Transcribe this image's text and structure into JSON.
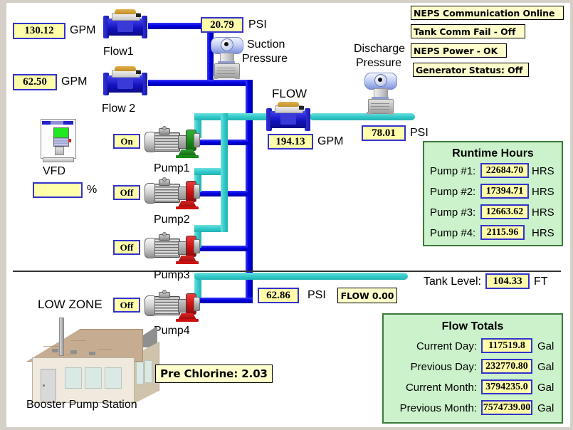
{
  "title": "Booster Pump Station",
  "flow_inputs": [
    {
      "name": "flow1",
      "value": "130.12",
      "unit": "GPM",
      "label": "Flow1"
    },
    {
      "name": "flow2",
      "value": "62.50",
      "unit": "GPM",
      "label": "Flow 2"
    }
  ],
  "suction": {
    "value": "20.79",
    "unit": "PSI",
    "label_line1": "Suction",
    "label_line2": "Pressure"
  },
  "discharge": {
    "value": "78.01",
    "unit": "PSI",
    "label_line1": "Discharge",
    "label_line2": "Pressure"
  },
  "main_flow": {
    "label": "FLOW",
    "value": "194.13",
    "unit": "GPM"
  },
  "low_zone_pressure": {
    "value": "62.86",
    "unit": "PSI"
  },
  "low_zone_flow_badge": "FLOW 0.00",
  "tank": {
    "label": "Tank Level:",
    "value": "104.33",
    "unit": "FT"
  },
  "vfd": {
    "label": "VFD",
    "speed": "",
    "unit": "%"
  },
  "pumps": [
    {
      "name": "Pump1",
      "state": "On"
    },
    {
      "name": "Pump2",
      "state": "Off"
    },
    {
      "name": "Pump3",
      "state": "Off"
    },
    {
      "name": "Pump4",
      "state": "Off"
    }
  ],
  "low_zone_label": "LOW ZONE",
  "pre_chlorine": "Pre Chlorine: 2.03",
  "station_label": "Booster Pump Station",
  "alarms": [
    {
      "name": "neps-comm",
      "text": "NEPS Communication Online"
    },
    {
      "name": "tank-comm-fail",
      "text": "Tank Comm Fail - Off"
    },
    {
      "name": "neps-power",
      "text": "NEPS Power - OK"
    },
    {
      "name": "generator-status",
      "text": "Generator Status: Off"
    }
  ],
  "runtime": {
    "title": "Runtime Hours",
    "unit": "HRS",
    "rows": [
      {
        "label": "Pump #1:",
        "value": "22684.70"
      },
      {
        "label": "Pump #2:",
        "value": "17394.71"
      },
      {
        "label": "Pump #3:",
        "value": "12663.62"
      },
      {
        "label": "Pump #4:",
        "value": "2115.96"
      }
    ]
  },
  "flow_totals": {
    "title": "Flow Totals",
    "unit": "Gal",
    "rows": [
      {
        "label": "Current Day:",
        "value": "117519.8"
      },
      {
        "label": "Previous Day:",
        "value": "232770.80"
      },
      {
        "label": "Current Month:",
        "value": "3794235.0"
      },
      {
        "label": "Previous Month:",
        "value": "7574739.00"
      }
    ]
  },
  "colors": {
    "pipe_suction": "#0000ee",
    "pipe_discharge": "#35cccc",
    "value_fill": "#ffffaa",
    "value_border": "#3333cc",
    "panel_fill": "#ccf2cc",
    "panel_border": "#3a7a3a",
    "pump_running": "#1a8a1a",
    "pump_stopped": "#dd1111"
  }
}
